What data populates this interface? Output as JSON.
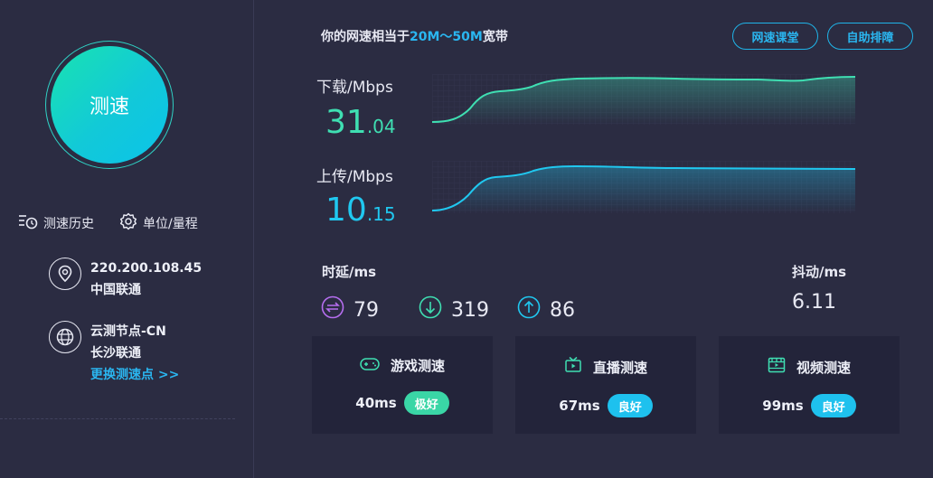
{
  "left": {
    "test_button": "测速",
    "history_label": "测速历史",
    "unit_label": "单位/量程",
    "ip": "220.200.108.45",
    "isp": "中国联通",
    "node_name": "云测节点-CN",
    "node_location": "长沙联通",
    "change_node": "更换测速点 >>"
  },
  "header": {
    "bandwidth_prefix": "你的网速相当于",
    "bandwidth_range": "20M～50M",
    "bandwidth_suffix": "宽带",
    "course_button": "网速课堂",
    "troubleshoot_button": "自助排障"
  },
  "download": {
    "label": "下载/Mbps",
    "int": "31",
    "dec": ".04",
    "color": "#3fdfb2"
  },
  "upload": {
    "label": "上传/Mbps",
    "int": "10",
    "dec": ".15",
    "color": "#20c8f0"
  },
  "latency": {
    "title": "时延/ms",
    "idle": "79",
    "down": "319",
    "up": "86",
    "icons": [
      "swap-icon",
      "arrow-down-icon",
      "arrow-up-icon"
    ]
  },
  "jitter": {
    "title": "抖动/ms",
    "value": "6.11"
  },
  "cards": [
    {
      "title": "游戏测速",
      "ms": "40ms",
      "rating": "极好",
      "icon": "gamepad-icon"
    },
    {
      "title": "直播测速",
      "ms": "67ms",
      "rating": "良好",
      "icon": "tv-icon"
    },
    {
      "title": "视频测速",
      "ms": "99ms",
      "rating": "良好",
      "icon": "film-icon"
    }
  ]
}
